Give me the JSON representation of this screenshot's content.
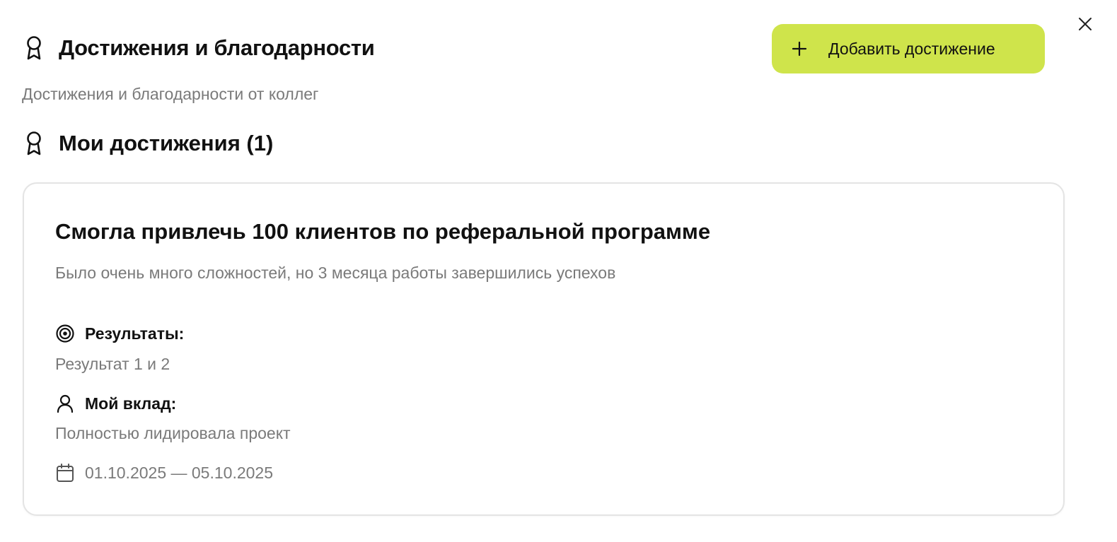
{
  "header": {
    "title": "Достижения и благодарности",
    "subtitle": "Достижения и благодарности от коллег",
    "add_button_label": "Добавить достижение",
    "medal_icon": "award-icon",
    "close_icon": "close-icon"
  },
  "section": {
    "title": "Мои достижения (1)"
  },
  "achievements": [
    {
      "title": "Смогла привлечь 100 клиентов по реферальной программе",
      "description": "Было очень много сложностей, но 3 месяца работы завершились успехов",
      "results_label": "Результаты:",
      "results_value": "Результат 1 и 2",
      "contribution_label": "Мой вклад:",
      "contribution_value": "Полностью лидировала проект",
      "date_range": "01.10.2025 — 05.10.2025"
    }
  ],
  "colors": {
    "accent": "#cfe44b",
    "muted_text": "#7a7a7a",
    "border": "#e4e4e4"
  }
}
